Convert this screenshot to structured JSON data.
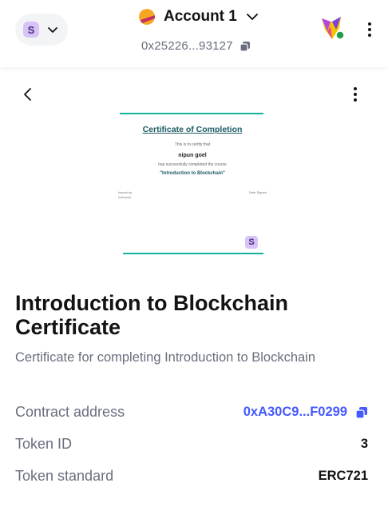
{
  "header": {
    "network_avatar_letter": "S",
    "account_name": "Account 1",
    "account_address": "0x25226...93127"
  },
  "certificate": {
    "title": "Certificate of Completion",
    "line1": "This is to certify that",
    "recipient": "nipun goel",
    "line2": "has successfully completed the course",
    "course": "\"Introduction to Blockchain\"",
    "sig_left": "Issued by Instructor",
    "sig_right": "Date Signed",
    "badge_letter": "S"
  },
  "nft": {
    "title": "Introduction to Blockchain Certificate",
    "description": "Certificate for completing Introduction to Blockchain"
  },
  "details": {
    "contract_label": "Contract address",
    "contract_value": "0xA30C9...F0299",
    "token_id_label": "Token ID",
    "token_id_value": "3",
    "standard_label": "Token standard",
    "standard_value": "ERC721"
  },
  "colors": {
    "accent": "#4459ff",
    "muted": "#686e7d",
    "teal": "#14b3a0",
    "badge_bg": "#d7c3f5"
  },
  "icons": {
    "network_chevron": "chevron-down-icon",
    "account_chevron": "chevron-down-icon",
    "copy": "copy-icon",
    "fox": "metamask-fox-icon",
    "menu": "kebab-menu-icon",
    "back": "chevron-left-icon"
  }
}
